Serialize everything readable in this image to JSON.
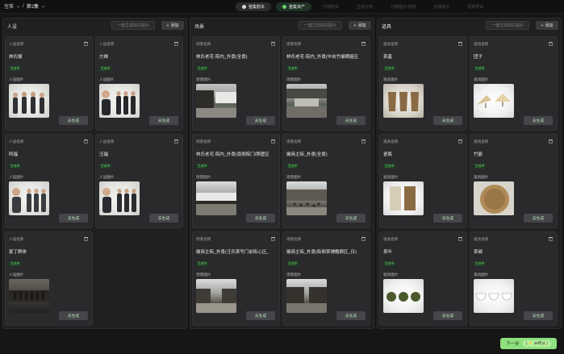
{
  "breadcrumb": {
    "project": "宫茶",
    "episode": "第2集"
  },
  "steps": [
    {
      "label": "整集剧本",
      "state": "done"
    },
    {
      "label": "整集资产",
      "state": "current"
    },
    {
      "label": "分镜剧本",
      "state": "todo"
    },
    {
      "label": "生成分镜",
      "state": "todo"
    },
    {
      "label": "分镜图片/视频",
      "state": "todo"
    },
    {
      "label": "剪辑成片",
      "state": "todo"
    },
    {
      "label": "视频导出",
      "state": "todo"
    }
  ],
  "common": {
    "generate_all": "一键生成缺失图片",
    "add": "添加",
    "go_generate": "去生成",
    "status": "生成中",
    "image_label": "人设图片"
  },
  "people": {
    "title": "人设",
    "name_label": "人设名称",
    "items": [
      {
        "name": "林氏嫂"
      },
      {
        "name": "方婵"
      },
      {
        "name": "阿福"
      },
      {
        "name": "汪福"
      },
      {
        "name": "家丁群体"
      }
    ]
  },
  "scenes": {
    "title": "场景",
    "name_label": "场景名称",
    "image_label": "场景图片",
    "items": [
      {
        "name": "林氏老宅·院内_外景(全景)"
      },
      {
        "name": "林氏老宅·院内_外景(中央竹编晒匾区"
      },
      {
        "name": "林氏老宅·院内_外景(南侧院门/照壁区"
      },
      {
        "name": "徽商主街_外景(全景)"
      },
      {
        "name": "徽商主街_外景(汪氏茶号门前街心区_"
      },
      {
        "name": "徽商主街_外景(街侧茶铺檐廊区_日)"
      }
    ]
  },
  "props": {
    "title": "道具",
    "name_label": "道具名称",
    "image_label": "道具图片",
    "items": [
      {
        "name": "茶篓"
      },
      {
        "name": "团子"
      },
      {
        "name": "瓷瓶"
      },
      {
        "name": "竹匾"
      },
      {
        "name": "茶叶"
      },
      {
        "name": "茶碗"
      }
    ]
  },
  "next_button": {
    "label": "下一步",
    "cost": "38积分"
  },
  "colors": {
    "accent": "#6dd36d",
    "next": "#8fe07e",
    "panel": "#202022",
    "card": "#2a2a2d"
  }
}
